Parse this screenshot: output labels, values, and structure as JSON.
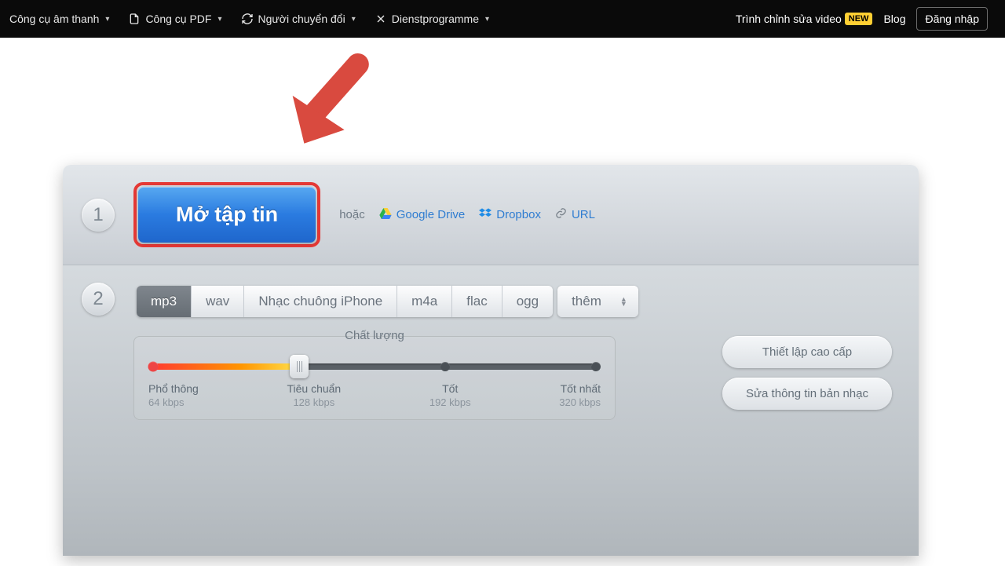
{
  "nav": {
    "items": [
      {
        "label": "Công cụ âm thanh",
        "icon": "audio"
      },
      {
        "label": "Công cụ PDF",
        "icon": "pdf"
      },
      {
        "label": "Người chuyển đổi",
        "icon": "convert"
      },
      {
        "label": "Dienstprogramme",
        "icon": "utils"
      }
    ],
    "video_editor": "Trình chỉnh sửa video",
    "new_badge": "NEW",
    "blog": "Blog",
    "login": "Đăng nhập"
  },
  "step1": {
    "number": "1",
    "open_file": "Mở tập tin",
    "or": "hoặc",
    "google_drive": "Google Drive",
    "dropbox": "Dropbox",
    "url": "URL"
  },
  "step2": {
    "number": "2",
    "formats": [
      "mp3",
      "wav",
      "Nhạc chuông iPhone",
      "m4a",
      "flac",
      "ogg"
    ],
    "active_index": 0,
    "more": "thêm",
    "quality_title": "Chất lượng",
    "quality_levels": [
      {
        "name": "Phổ thông",
        "value": "64 kbps"
      },
      {
        "name": "Tiêu chuẩn",
        "value": "128 kbps"
      },
      {
        "name": "Tốt",
        "value": "192 kbps"
      },
      {
        "name": "Tốt nhất",
        "value": "320 kbps"
      }
    ],
    "advanced_btn": "Thiết lập cao cấp",
    "editinfo_btn": "Sửa thông tin bản nhạc"
  }
}
